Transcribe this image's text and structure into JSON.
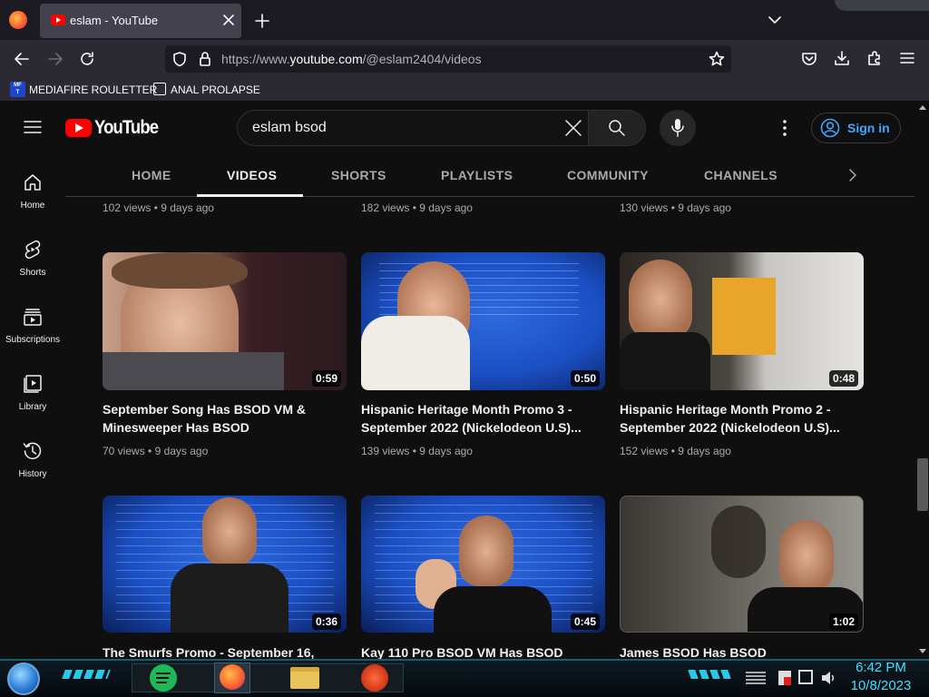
{
  "browser": {
    "tab_title": "eslam - YouTube",
    "url_prefix": "https://www.",
    "url_domain": "youtube.com",
    "url_path": "/@eslam2404/videos",
    "bookmarks": [
      {
        "label": "MEDIAFIRE ROULETTER",
        "icon": "mediafire-icon"
      },
      {
        "label": "ANAL PROLAPSE",
        "icon": "bookmark-page-icon"
      }
    ]
  },
  "youtube": {
    "logo_text": "YouTube",
    "search_value": "eslam bsod",
    "signin_label": "Sign in",
    "tabs": [
      "HOME",
      "VIDEOS",
      "SHORTS",
      "PLAYLISTS",
      "COMMUNITY",
      "CHANNELS"
    ],
    "active_tab": "VIDEOS",
    "sidebar": [
      {
        "label": "Home",
        "icon": "home-icon"
      },
      {
        "label": "Shorts",
        "icon": "shorts-icon"
      },
      {
        "label": "Subscriptions",
        "icon": "subscriptions-icon"
      },
      {
        "label": "Library",
        "icon": "library-icon"
      },
      {
        "label": "History",
        "icon": "history-icon"
      }
    ],
    "top_row_meta": [
      {
        "views": "102 views",
        "age": "9 days ago"
      },
      {
        "views": "182 views",
        "age": "9 days ago"
      },
      {
        "views": "130 views",
        "age": "9 days ago"
      }
    ],
    "videos": [
      {
        "title": "September Song Has BSOD VM & Minesweeper Has BSOD",
        "duration": "0:59",
        "views": "70 views",
        "age": "9 days ago"
      },
      {
        "title": "Hispanic Heritage Month Promo 3 - September 2022 (Nickelodeon U.S)...",
        "duration": "0:50",
        "views": "139 views",
        "age": "9 days ago"
      },
      {
        "title": "Hispanic Heritage Month Promo 2 - September 2022 (Nickelodeon U.S)...",
        "duration": "0:48",
        "views": "152 views",
        "age": "9 days ago"
      },
      {
        "title": "The Smurfs Promo - September 16,",
        "duration": "0:36",
        "views": "",
        "age": ""
      },
      {
        "title": "Kay 110 Pro BSOD VM Has BSOD",
        "duration": "0:45",
        "views": "",
        "age": ""
      },
      {
        "title": "James BSOD Has BSOD",
        "duration": "1:02",
        "views": "",
        "age": ""
      }
    ]
  },
  "taskbar": {
    "time": "6:42 PM",
    "date": "10/8/2023"
  },
  "colors": {
    "yt_red": "#ff0000",
    "signin_blue": "#3ea6ff",
    "bsod_blue": "#1b4fc4",
    "clock_cyan": "#3fe0ff"
  }
}
